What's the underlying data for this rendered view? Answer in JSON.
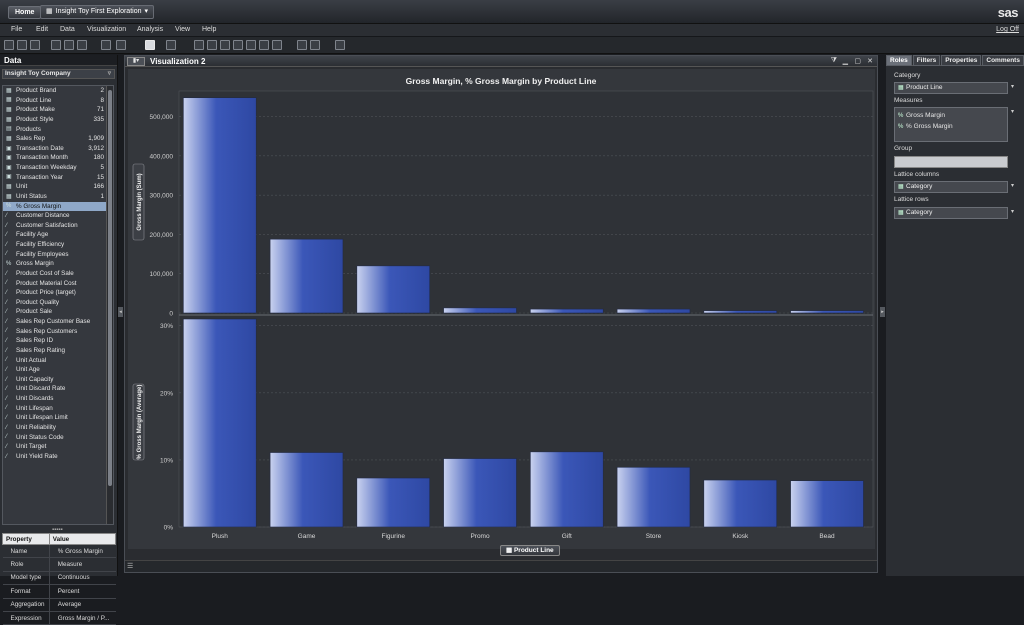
{
  "topbar": {
    "home_label": "Home",
    "doc_tab_label": "Insight Toy First Exploration",
    "brand": "sas"
  },
  "menu": {
    "items": [
      "File",
      "Edit",
      "Data",
      "Visualization",
      "Analysis",
      "View",
      "Help"
    ],
    "logoff": "Log Off"
  },
  "toolbar": {
    "icons": [
      "new-icon",
      "open-icon",
      "save-icon",
      "undo-icon",
      "redo-icon",
      "export-icon",
      "copy-icon",
      "paste-icon",
      "pointer-icon",
      "brush-icon",
      "table-icon",
      "crosstab-icon",
      "bar-chart-icon",
      "line-chart-icon",
      "scatter-icon",
      "bubble-icon",
      "network-icon",
      "histogram-icon",
      "box-plot-icon",
      "heatmap-icon",
      "geo-map-icon",
      "treemap-icon",
      "layout-icon"
    ]
  },
  "data_panel": {
    "header": "Data",
    "data_source": "Insight Toy Company",
    "items": [
      {
        "name": "Product Brand",
        "count": "2",
        "icon": "category-icon"
      },
      {
        "name": "Product Line",
        "count": "8",
        "icon": "category-icon"
      },
      {
        "name": "Product Make",
        "count": "71",
        "icon": "category-icon"
      },
      {
        "name": "Product Style",
        "count": "335",
        "icon": "category-icon"
      },
      {
        "name": "Products",
        "count": "",
        "icon": "hierarchy-icon"
      },
      {
        "name": "Sales Rep",
        "count": "1,909",
        "icon": "category-icon"
      },
      {
        "name": "Transaction Date",
        "count": "3,912",
        "icon": "date-icon"
      },
      {
        "name": "Transaction Month",
        "count": "180",
        "icon": "date-icon"
      },
      {
        "name": "Transaction Weekday",
        "count": "5",
        "icon": "date-icon"
      },
      {
        "name": "Transaction Year",
        "count": "15",
        "icon": "date-icon"
      },
      {
        "name": "Unit",
        "count": "166",
        "icon": "category-icon"
      },
      {
        "name": "Unit Status",
        "count": "1",
        "icon": "category-icon"
      },
      {
        "name": "% Gross Margin",
        "count": "",
        "icon": "calculated-icon",
        "selected": true
      },
      {
        "name": "Customer Distance",
        "count": "",
        "icon": "measure-icon"
      },
      {
        "name": "Customer Satisfaction",
        "count": "",
        "icon": "measure-icon"
      },
      {
        "name": "Facility Age",
        "count": "",
        "icon": "measure-icon"
      },
      {
        "name": "Facility Efficiency",
        "count": "",
        "icon": "measure-icon"
      },
      {
        "name": "Facility Employees",
        "count": "",
        "icon": "measure-icon"
      },
      {
        "name": "Gross Margin",
        "count": "",
        "icon": "calculated-icon"
      },
      {
        "name": "Product Cost of Sale",
        "count": "",
        "icon": "measure-icon"
      },
      {
        "name": "Product Material Cost",
        "count": "",
        "icon": "measure-icon"
      },
      {
        "name": "Product Price (target)",
        "count": "",
        "icon": "measure-icon"
      },
      {
        "name": "Product Quality",
        "count": "",
        "icon": "measure-icon"
      },
      {
        "name": "Product Sale",
        "count": "",
        "icon": "measure-icon"
      },
      {
        "name": "Sales Rep Customer Base",
        "count": "",
        "icon": "measure-icon"
      },
      {
        "name": "Sales Rep Customers",
        "count": "",
        "icon": "measure-icon"
      },
      {
        "name": "Sales Rep ID",
        "count": "",
        "icon": "measure-icon"
      },
      {
        "name": "Sales Rep Rating",
        "count": "",
        "icon": "measure-icon"
      },
      {
        "name": "Unit Actual",
        "count": "",
        "icon": "measure-icon"
      },
      {
        "name": "Unit Age",
        "count": "",
        "icon": "measure-icon"
      },
      {
        "name": "Unit Capacity",
        "count": "",
        "icon": "measure-icon"
      },
      {
        "name": "Unit Discard Rate",
        "count": "",
        "icon": "measure-icon"
      },
      {
        "name": "Unit Discards",
        "count": "",
        "icon": "measure-icon"
      },
      {
        "name": "Unit Lifespan",
        "count": "",
        "icon": "measure-icon"
      },
      {
        "name": "Unit Lifespan Limit",
        "count": "",
        "icon": "measure-icon"
      },
      {
        "name": "Unit Reliability",
        "count": "",
        "icon": "measure-icon"
      },
      {
        "name": "Unit Status Code",
        "count": "",
        "icon": "measure-icon"
      },
      {
        "name": "Unit Target",
        "count": "",
        "icon": "measure-icon"
      },
      {
        "name": "Unit Yield Rate",
        "count": "",
        "icon": "measure-icon"
      }
    ]
  },
  "properties": {
    "headers": [
      "Property",
      "Value"
    ],
    "rows": [
      [
        "Name",
        "% Gross Margin"
      ],
      [
        "Role",
        "Measure"
      ],
      [
        "Model type",
        "Continuous"
      ],
      [
        "Format",
        "Percent"
      ],
      [
        "Aggregation",
        "Average"
      ],
      [
        "Expression",
        "Gross Margin / P..."
      ]
    ]
  },
  "visualization": {
    "title": "Visualization 2",
    "legend_chip": "Product Line"
  },
  "roles_panel": {
    "tabs": [
      "Roles",
      "Filters",
      "Properties",
      "Comments"
    ],
    "active_tab": "Roles",
    "category_label": "Category",
    "category_value": "Product Line",
    "measures_label": "Measures",
    "measures": [
      "Gross Margin",
      "% Gross Margin"
    ],
    "group_label": "Group",
    "group_value": "",
    "lattice_columns_label": "Lattice columns",
    "lattice_columns_value": "Category",
    "lattice_rows_label": "Lattice rows",
    "lattice_rows_value": "Category"
  },
  "chart_data": {
    "type": "bar",
    "title": "Gross Margin, % Gross Margin by Product Line",
    "categories": [
      "Plush",
      "Game",
      "Figurine",
      "Promo",
      "Gift",
      "Store",
      "Kiosk",
      "Bead"
    ],
    "xlabel": "Product Line",
    "bar_color": "#3b57b8",
    "grid": true,
    "panels": [
      {
        "ylabel": "Gross Margin (Sum)",
        "values": [
          548000,
          188000,
          120000,
          13000,
          10000,
          10000,
          6000,
          6000
        ],
        "ylim": [
          0,
          560000
        ],
        "ticks": [
          0,
          100000,
          200000,
          300000,
          400000,
          500000
        ],
        "tick_labels": [
          "0",
          "100,000",
          "200,000",
          "300,000",
          "400,000",
          "500,000"
        ]
      },
      {
        "ylabel": "% Gross Margin (Average)",
        "values": [
          0.31,
          0.111,
          0.073,
          0.102,
          0.112,
          0.089,
          0.07,
          0.069
        ],
        "ylim": [
          0,
          0.31
        ],
        "ticks": [
          0,
          0.1,
          0.2,
          0.3
        ],
        "tick_labels": [
          "0%",
          "10%",
          "20%",
          "30%"
        ]
      }
    ]
  }
}
